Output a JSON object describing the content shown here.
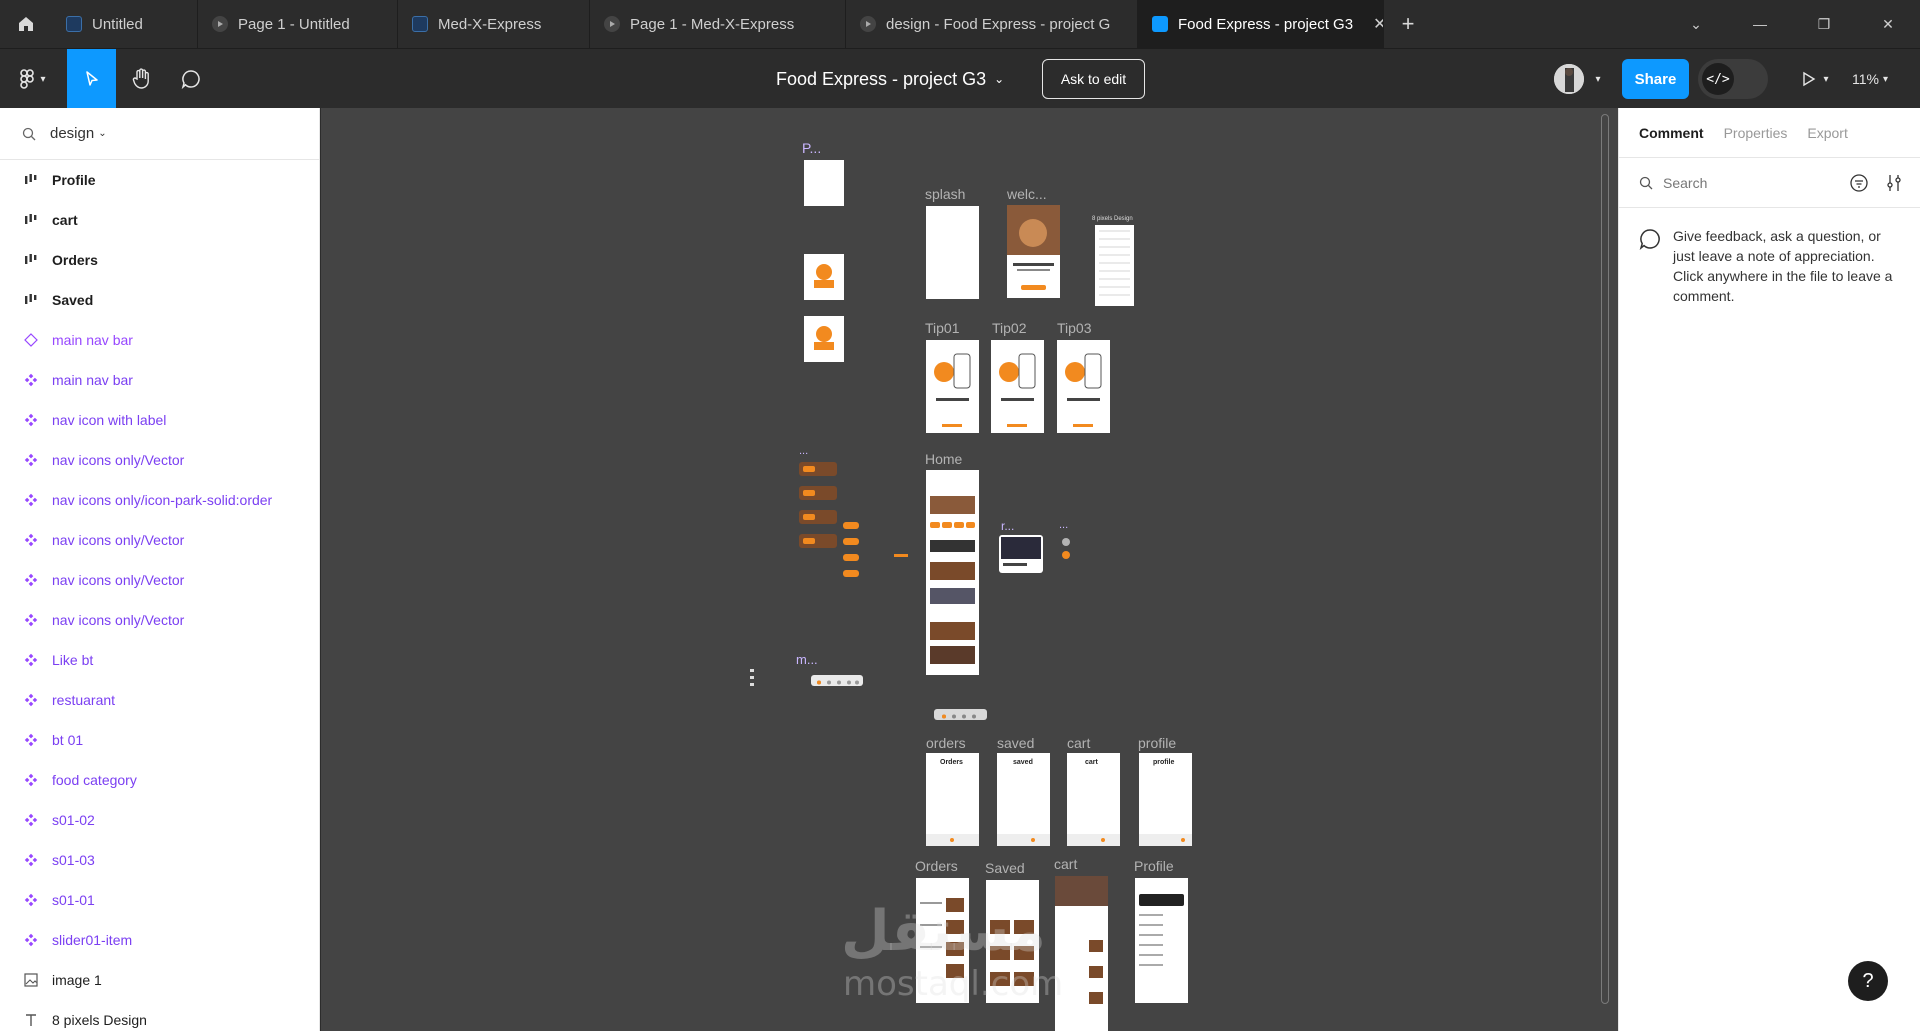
{
  "tabs": [
    {
      "label": "Untitled",
      "icon": "design-file-icon"
    },
    {
      "label": "Page 1 - Untitled",
      "icon": "prototype-icon"
    },
    {
      "label": "Med-X-Express",
      "icon": "design-file-icon"
    },
    {
      "label": "Page 1 - Med-X-Express",
      "icon": "prototype-icon"
    },
    {
      "label": "design - Food Express - project G",
      "icon": "prototype-icon"
    },
    {
      "label": "Food Express - project G3",
      "icon": "design-file-icon",
      "active": true
    }
  ],
  "toolbar": {
    "file_title": "Food Express - project G3",
    "ask_to_edit": "Ask to edit",
    "share": "Share",
    "dev_mode": "</>",
    "zoom": "11%"
  },
  "left_panel": {
    "page": "design",
    "layers": [
      {
        "label": "Profile",
        "kind": "frame"
      },
      {
        "label": "cart",
        "kind": "frame"
      },
      {
        "label": "Orders",
        "kind": "frame"
      },
      {
        "label": "Saved",
        "kind": "frame"
      },
      {
        "label": "main nav bar",
        "kind": "component-set"
      },
      {
        "label": "main nav bar",
        "kind": "component"
      },
      {
        "label": "nav icon with label",
        "kind": "component"
      },
      {
        "label": "nav icons only/Vector",
        "kind": "component"
      },
      {
        "label": "nav icons only/icon-park-solid:order",
        "kind": "component"
      },
      {
        "label": "nav icons only/Vector",
        "kind": "component"
      },
      {
        "label": "nav icons only/Vector",
        "kind": "component"
      },
      {
        "label": "nav icons only/Vector",
        "kind": "component"
      },
      {
        "label": "Like bt",
        "kind": "component"
      },
      {
        "label": "restuarant",
        "kind": "component"
      },
      {
        "label": "bt 01",
        "kind": "component"
      },
      {
        "label": "food category",
        "kind": "component"
      },
      {
        "label": "s01-02",
        "kind": "component"
      },
      {
        "label": "s01-03",
        "kind": "component"
      },
      {
        "label": "s01-01",
        "kind": "component"
      },
      {
        "label": "slider01-item",
        "kind": "component"
      },
      {
        "label": "image 1",
        "kind": "image"
      },
      {
        "label": "8 pixels Design",
        "kind": "text"
      }
    ]
  },
  "canvas": {
    "frame_labels": {
      "p_comp": "P...",
      "splash": "splash",
      "welcome": "welc...",
      "eight_px": "8 pixels Design",
      "tip01": "Tip01",
      "tip02": "Tip02",
      "tip03": "Tip03",
      "home": "Home",
      "r_comp": "r...",
      "m_comp": "m...",
      "orders_small": "orders",
      "saved_small": "saved",
      "cart_small": "cart",
      "profile_small": "profile",
      "orders": "Orders",
      "saved": "Saved",
      "cart": "cart",
      "profile": "Profile",
      "ellipsis": "..."
    },
    "frame_headers": {
      "orders": "Orders",
      "saved": "saved",
      "cart": "cart",
      "profile": "profile"
    },
    "watermark": {
      "arabic": "مستقل",
      "latin": "mostaql.com"
    }
  },
  "right_panel": {
    "tabs": [
      "Comment",
      "Properties",
      "Export"
    ],
    "active_tab": "Comment",
    "search_placeholder": "Search",
    "hint": "Give feedback, ask a question, or just leave a note of appreciation. Click anywhere in the file to leave a comment."
  },
  "help": "?",
  "colors": {
    "accent": "#0d99ff",
    "chrome": "#2c2c2c",
    "canvas": "#444444",
    "component": "#9747ff",
    "brand_orange": "#f28a1f"
  }
}
